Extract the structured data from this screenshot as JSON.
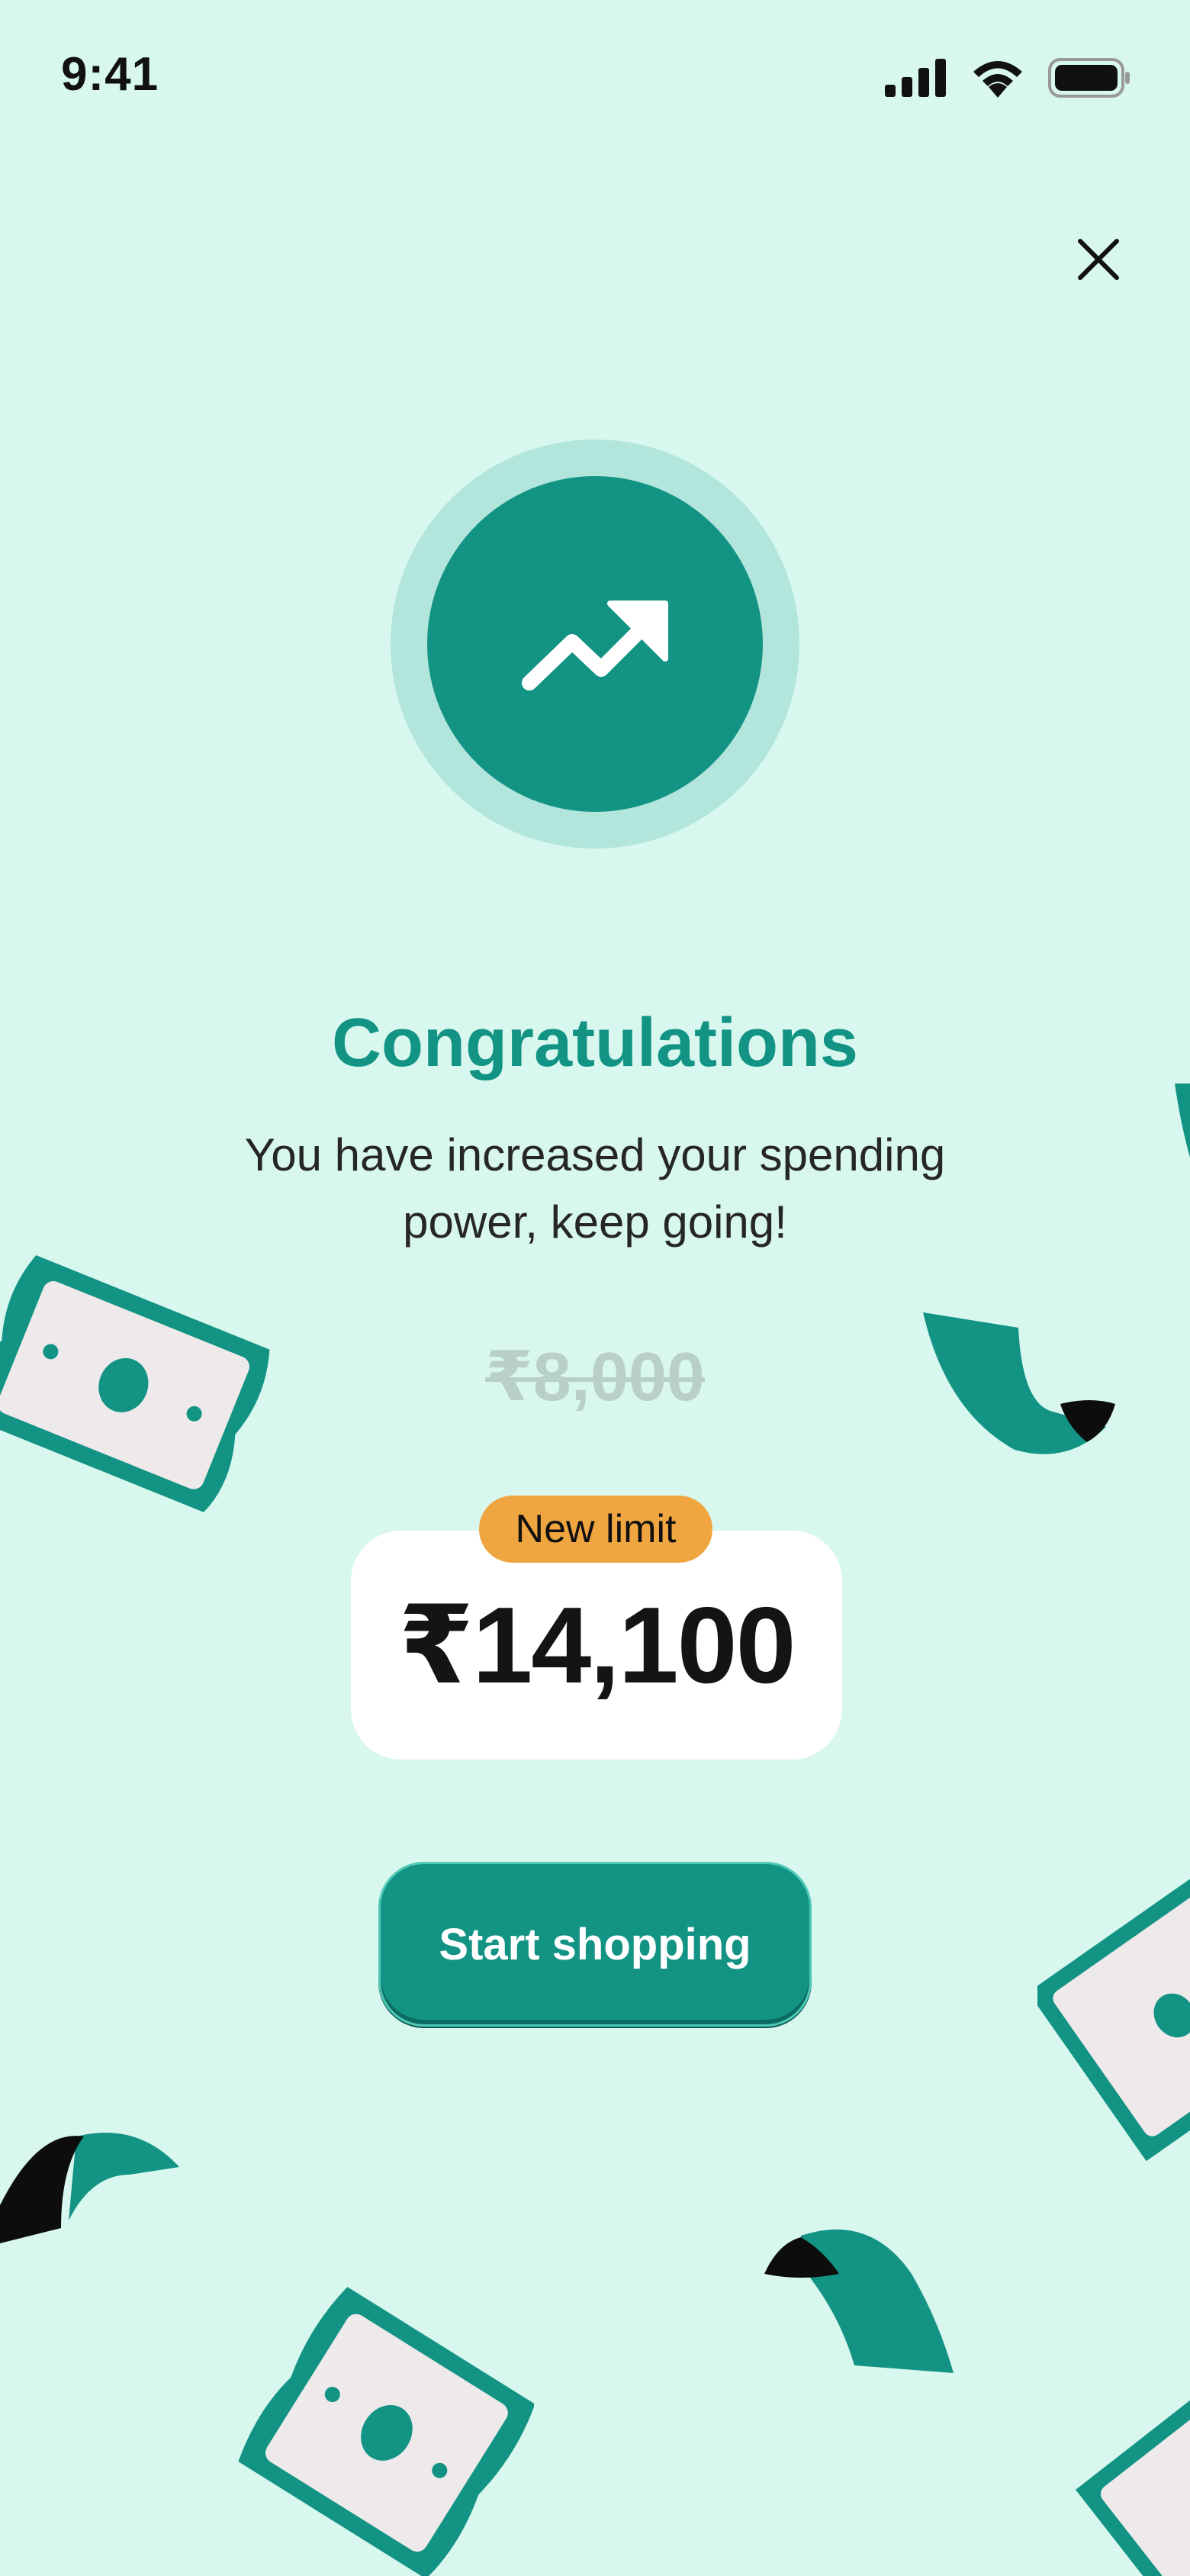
{
  "status_bar": {
    "time": "9:41",
    "icons": [
      "signal-icon",
      "wifi-icon",
      "battery-icon"
    ]
  },
  "close": {
    "icon": "close-icon"
  },
  "badge": {
    "icon": "trending-up-icon"
  },
  "title": "Congratulations",
  "subtitle": "You have increased your spending power, keep going!",
  "limit": {
    "old_value": "₹8,000",
    "tag_label": "New limit",
    "new_value": "₹14,100"
  },
  "cta": {
    "label": "Start shopping"
  },
  "colors": {
    "background": "#D8F8EF",
    "brand": "#129384",
    "badge_ring": "#B2E6DC",
    "tag": "#F0A640",
    "old_value": "#B9CFCA"
  }
}
